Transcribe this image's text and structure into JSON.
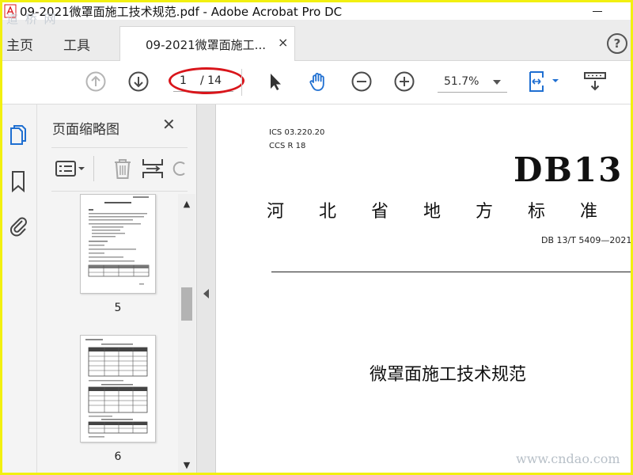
{
  "window": {
    "title": "09-2021微罩面施工技术规范.pdf - Adobe Acrobat Pro DC"
  },
  "menu": {
    "home": "主页",
    "tools": "工具"
  },
  "tab": {
    "label": "09-2021微罩面施工...",
    "close": "×"
  },
  "help": "?",
  "toolbar": {
    "page_current": "1",
    "page_total": "/ 14",
    "zoom": "51.7%"
  },
  "panel": {
    "title": "页面缩略图",
    "close": "✕",
    "thumbnails": [
      {
        "page": "5"
      },
      {
        "page": "6"
      }
    ]
  },
  "document": {
    "ics": "ICS  03.220.20",
    "ccs": "CCS  R 18",
    "db": "DB13",
    "standard_line": "河北省地方标准",
    "code": "DB 13/T 5409—2021",
    "title": "微罩面施工技术规范"
  },
  "watermarks": {
    "top_left": "道 桥 网",
    "bottom_right": "www.cndao.com"
  },
  "colors": {
    "accent_blue": "#1f6fd1",
    "highlight_red": "#d9151b",
    "frame_yellow": "#f2f010"
  }
}
